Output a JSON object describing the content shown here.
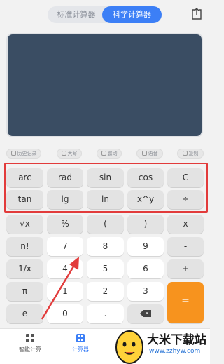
{
  "header": {
    "tabs": [
      {
        "label": "标准计算器",
        "active": false
      },
      {
        "label": "科学计算器",
        "active": true
      }
    ],
    "export_icon": "export-icon"
  },
  "display": {
    "background": "#3a4d63"
  },
  "utilities": [
    {
      "label": "历史记录",
      "icon": "history-icon"
    },
    {
      "label": "大写",
      "icon": "uppercase-icon"
    },
    {
      "label": "震动",
      "icon": "vibration-icon"
    },
    {
      "label": "语音",
      "icon": "voice-icon"
    },
    {
      "label": "复制",
      "icon": "copy-icon"
    }
  ],
  "keypad": {
    "row1": [
      "arc",
      "rad",
      "sin",
      "cos",
      "C"
    ],
    "row2": [
      "tan",
      "lg",
      "ln",
      "x^y",
      "÷"
    ],
    "row3": [
      "√x",
      "%",
      "(",
      ")",
      "x"
    ],
    "row4": [
      "n!",
      "7",
      "8",
      "9",
      "-"
    ],
    "row5": [
      "1/x",
      "4",
      "5",
      "6",
      "+"
    ],
    "row6": [
      "π",
      "1",
      "2",
      "3"
    ],
    "row7": [
      "e",
      "0",
      "."
    ],
    "equals": "=",
    "backspace_icon": "backspace-icon"
  },
  "bottom_nav": [
    {
      "label": "智能计算",
      "icon": "grid-icon",
      "active": false
    },
    {
      "label": "计算器",
      "icon": "calculator-icon",
      "active": true
    }
  ],
  "watermark": {
    "title": "大米下载站",
    "url": "www.zzhyw.com"
  },
  "colors": {
    "accent": "#3c7ff6",
    "equals": "#f7931e",
    "highlight": "#e23b3b",
    "display": "#3a4d63"
  }
}
